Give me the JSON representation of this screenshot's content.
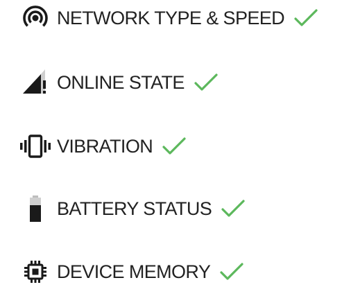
{
  "features": [
    {
      "label": "NETWORK TYPE & SPEED",
      "icon": "wifi-tethering-icon",
      "supported": true
    },
    {
      "label": "ONLINE STATE",
      "icon": "signal-alert-icon",
      "supported": true
    },
    {
      "label": "VIBRATION",
      "icon": "vibration-icon",
      "supported": true
    },
    {
      "label": "BATTERY STATUS",
      "icon": "battery-icon",
      "supported": true
    },
    {
      "label": "DEVICE MEMORY",
      "icon": "memory-chip-icon",
      "supported": true
    }
  ],
  "colors": {
    "text": "#222222",
    "icon": "#1a1a1a",
    "check": "#5cb85c"
  }
}
